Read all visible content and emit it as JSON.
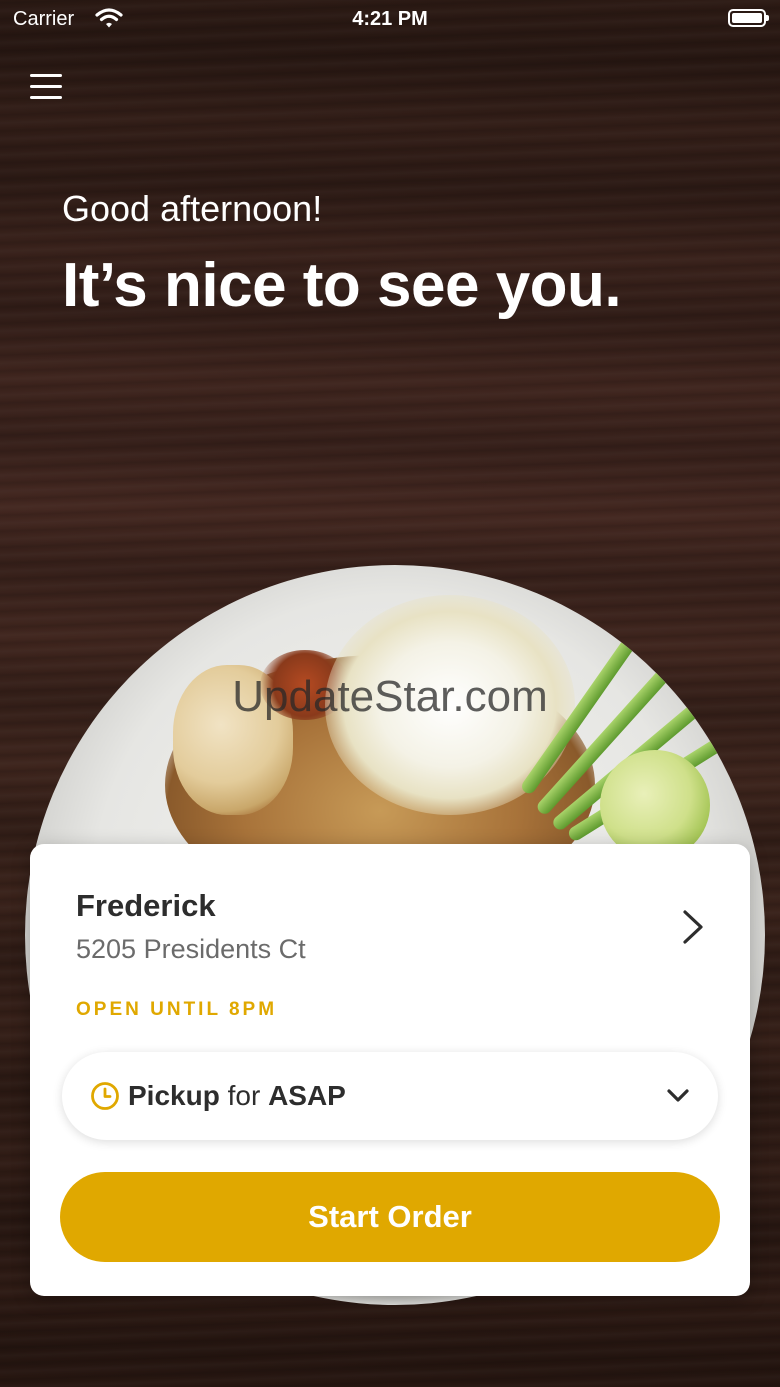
{
  "status_bar": {
    "carrier": "Carrier",
    "time": "4:21 PM"
  },
  "hero": {
    "greeting": "Good afternoon!",
    "headline": "It’s nice to see you."
  },
  "watermark": "UpdateStar.com",
  "store": {
    "name": "Frederick",
    "address": "5205 Presidents Ct",
    "hours": "OPEN UNTIL 8PM"
  },
  "order_mode": {
    "mode": "Pickup",
    "connector": "for",
    "time": "ASAP"
  },
  "start_order_label": "Start Order",
  "colors": {
    "accent": "#e0a800",
    "card": "#ffffff",
    "text_dark": "#2d2d2d",
    "text_muted": "#6b6b6b"
  },
  "icons": [
    "wifi-icon",
    "battery-icon",
    "hamburger-menu-icon",
    "chevron-right-icon",
    "clock-icon",
    "chevron-down-icon"
  ]
}
